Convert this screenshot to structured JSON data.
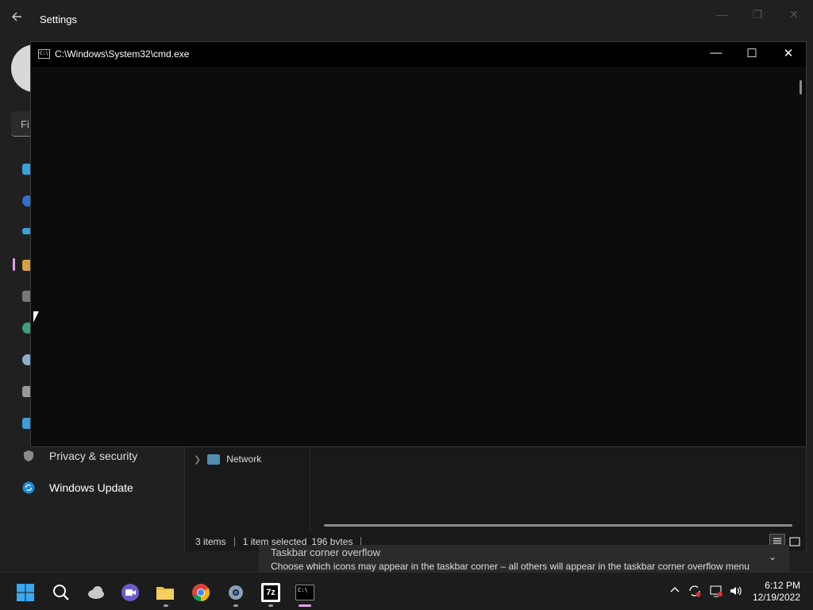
{
  "settings": {
    "title": "Settings",
    "find_placeholder": "Fi",
    "nav": [
      {
        "label": "Privacy & security",
        "icon": "shield-icon"
      },
      {
        "label": "Windows Update",
        "icon": "update-icon"
      }
    ],
    "fragment": {
      "title": "Taskbar corner overflow",
      "description": "Choose which icons may appear in the taskbar corner – all others will appear in the taskbar corner overflow menu"
    }
  },
  "explorer": {
    "tree_item": "Network",
    "status": {
      "items": "3 items",
      "selected": "1 item selected",
      "size": "196 bytes"
    }
  },
  "cmd": {
    "title": "C:\\Windows\\System32\\cmd.exe",
    "icon_text": "C:\\"
  },
  "taskbar": {
    "apps": [
      "start-icon",
      "search-icon",
      "onedrive-icon",
      "teams-icon",
      "file-explorer-icon",
      "chrome-icon",
      "settings-gear-icon",
      "7zip-icon",
      "cmd-icon"
    ],
    "app_7z_label": "7z",
    "time": "6:12 PM",
    "date": "12/19/2022"
  },
  "colors": {
    "accent": "#e0a0e8",
    "background": "#202020",
    "console": "#0c0c0c"
  }
}
